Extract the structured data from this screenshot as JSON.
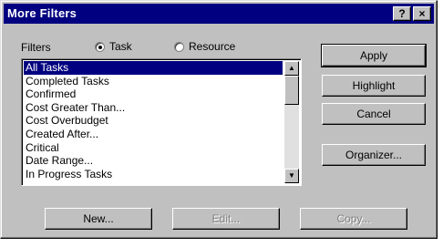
{
  "window": {
    "title": "More Filters",
    "help_label": "?",
    "close_label": "×"
  },
  "filters_label": "Filters",
  "radios": {
    "task_label": "Task",
    "resource_label": "Resource",
    "selected": "Task"
  },
  "list": {
    "items": [
      "All Tasks",
      "Completed Tasks",
      "Confirmed",
      "Cost Greater Than...",
      "Cost Overbudget",
      "Created After...",
      "Critical",
      "Date Range...",
      "In Progress Tasks"
    ],
    "selected_index": 0
  },
  "buttons": {
    "apply": "Apply",
    "highlight": "Highlight",
    "cancel": "Cancel",
    "organizer": "Organizer...",
    "new": "New...",
    "edit": "Edit...",
    "copy": "Copy..."
  }
}
